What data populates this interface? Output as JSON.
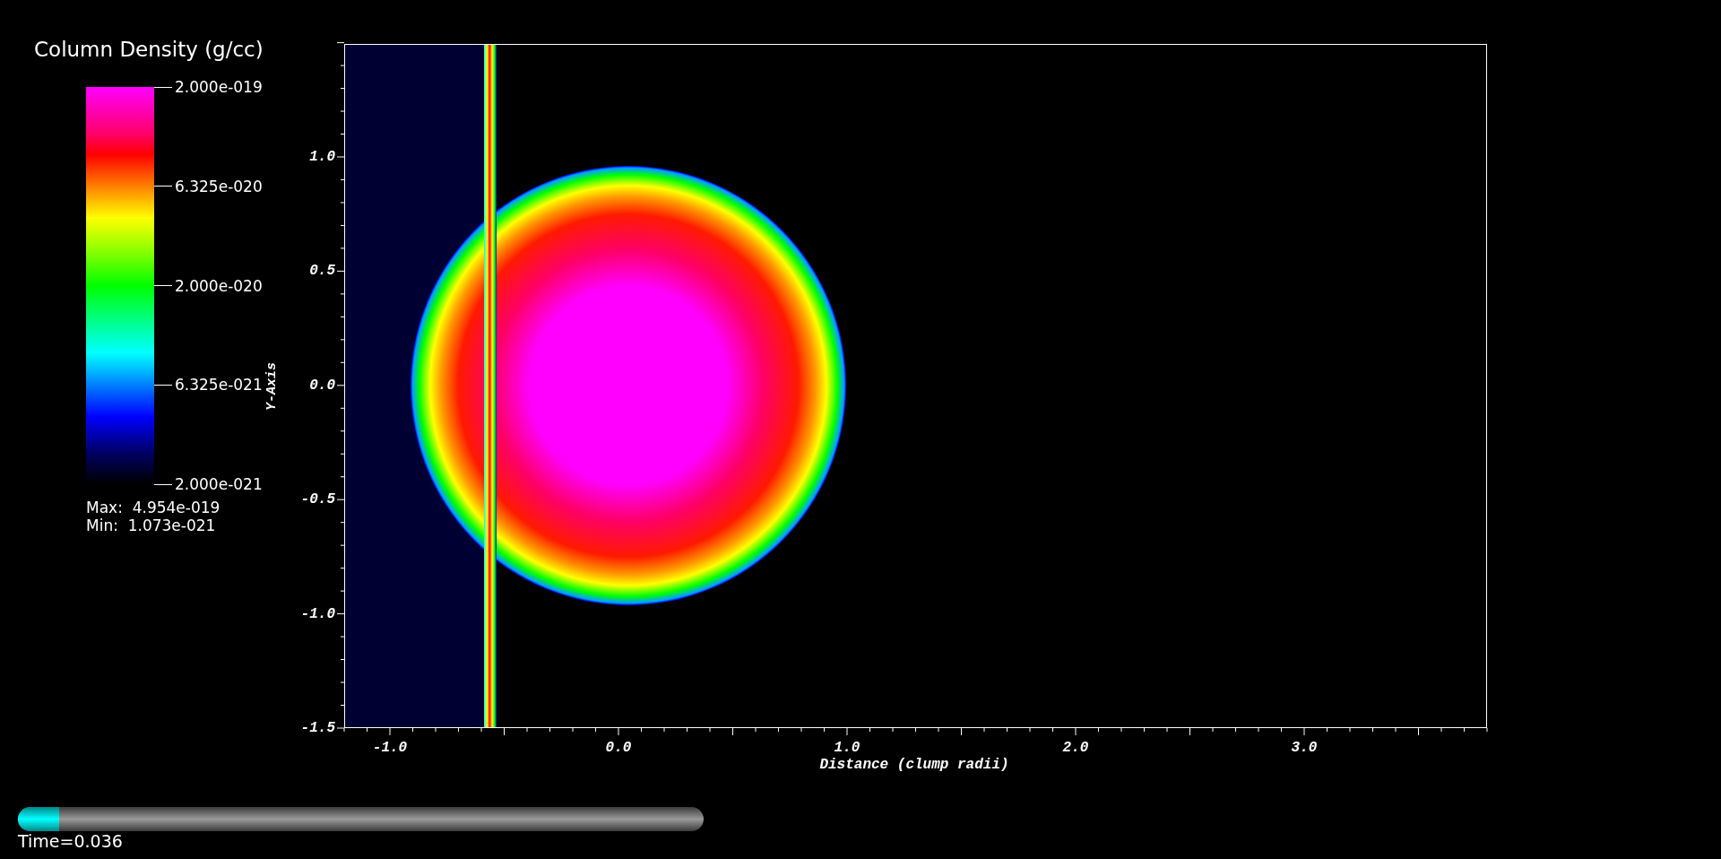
{
  "legend": {
    "title": "Column Density (g/cc)",
    "labels": [
      "2.000e-019",
      "6.325e-020",
      "2.000e-020",
      "6.325e-021",
      "2.000e-021"
    ],
    "max": "Max:  4.954e-019",
    "min": "Min:  1.073e-021"
  },
  "plot": {
    "y_axis_title": "Y-Axis",
    "x_axis_title": "Distance (clump radii)",
    "yticks": [
      "1.0",
      "0.5",
      "0.0",
      "-0.5",
      "-1.0",
      "-1.5"
    ],
    "xticks": [
      "-1.0",
      "0.0",
      "1.0",
      "2.0",
      "3.0"
    ]
  },
  "time_slider": {
    "level": 0.06,
    "label": "Time=0.036"
  }
}
